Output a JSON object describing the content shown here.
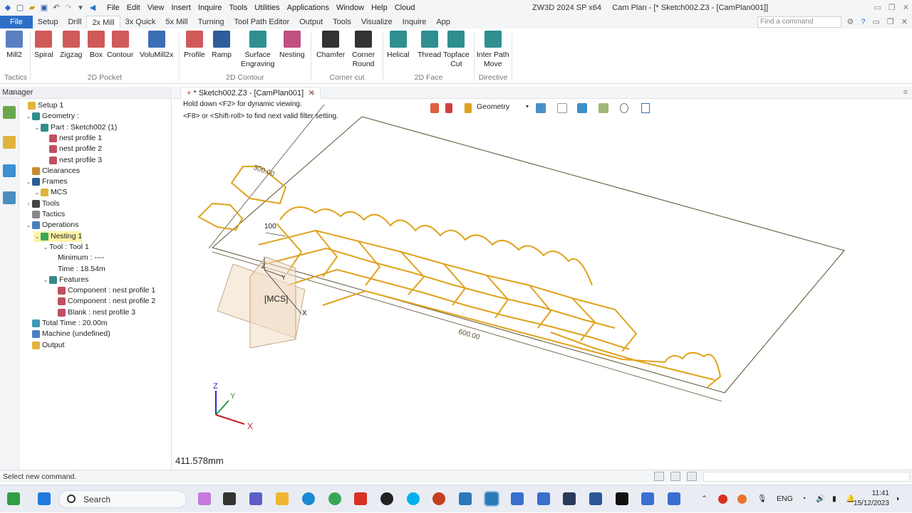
{
  "title_bar": {
    "menu": [
      "File",
      "Edit",
      "View",
      "Insert",
      "Inquire",
      "Tools",
      "Utilities",
      "Applications",
      "Window",
      "Help",
      "Cloud"
    ],
    "app_title": "ZW3D 2024 SP x64     Cam Plan - [* Sketch002.Z3 - [CamPlan001]]"
  },
  "ribbon_tabs": [
    "File",
    "Setup",
    "Drill",
    "2x Mill",
    "3x Quick",
    "5x Mill",
    "Turning",
    "Tool Path Editor",
    "Output",
    "Tools",
    "Visualize",
    "Inquire",
    "App"
  ],
  "active_tab": "2x Mill",
  "command_search": {
    "placeholder": "Find a command"
  },
  "ribbon": {
    "buttons": [
      {
        "label": "Mill2",
        "icon": "mill2-icon",
        "color": "#5a7fc0"
      },
      {
        "label": "Spiral",
        "icon": "spiral-icon",
        "color": "#d05a5a"
      },
      {
        "label": "Zigzag",
        "icon": "zigzag-icon",
        "color": "#d05a5a"
      },
      {
        "label": "Box",
        "icon": "box-icon",
        "color": "#d05a5a"
      },
      {
        "label": "Contour",
        "icon": "contour-icon",
        "color": "#d05a5a"
      },
      {
        "label": "VoluMill2x",
        "icon": "volumill-icon",
        "color": "#3b6fb5"
      },
      {
        "label": "Profile",
        "icon": "profile-icon",
        "color": "#d05a5a"
      },
      {
        "label": "Ramp",
        "icon": "ramp-icon",
        "color": "#2f5d9a"
      },
      {
        "label": "Surface\nEngraving",
        "icon": "engraving-icon",
        "color": "#2f8f8f"
      },
      {
        "label": "Nesting",
        "icon": "nesting-icon",
        "color": "#c05080"
      },
      {
        "label": "Chamfer",
        "icon": "chamfer-icon",
        "color": "#333333"
      },
      {
        "label": "Corner\nRound",
        "icon": "corner-round-icon",
        "color": "#333333"
      },
      {
        "label": "Helical",
        "icon": "helical-icon",
        "color": "#2f8f8f"
      },
      {
        "label": "Thread",
        "icon": "thread-icon",
        "color": "#2f8f8f"
      },
      {
        "label": "Topface\nCut",
        "icon": "topface-icon",
        "color": "#2f8f8f"
      },
      {
        "label": "Inter Path\nMove",
        "icon": "inter-path-icon",
        "color": "#2f8f8f"
      }
    ],
    "groups": [
      "Tactics",
      "2D Pocket",
      "2D Contour",
      "Corner cut",
      "2D Face",
      "Directive"
    ]
  },
  "manager": {
    "title": "Manager",
    "tree": [
      {
        "label": "Setup 1",
        "icon": "setup-icon"
      },
      {
        "label": "Geometry :",
        "icon": "geometry-icon"
      },
      {
        "label": "Part : Sketch002 (1)",
        "icon": "part-icon"
      },
      {
        "label": "nest profile 1",
        "icon": "profile-icon"
      },
      {
        "label": "nest profile 2",
        "icon": "profile-icon"
      },
      {
        "label": "nest profile 3",
        "icon": "profile-icon"
      },
      {
        "label": "Clearances",
        "icon": "clearances-icon"
      },
      {
        "label": "Frames",
        "icon": "frames-icon"
      },
      {
        "label": "MCS",
        "icon": "mcs-icon"
      },
      {
        "label": "Tools",
        "icon": "tools-icon"
      },
      {
        "label": "Tactics",
        "icon": "tactics-icon"
      },
      {
        "label": "Operations",
        "icon": "operations-icon"
      },
      {
        "label": "Nesting 1",
        "icon": "check-icon"
      },
      {
        "label": "Tool : Tool 1",
        "icon": ""
      },
      {
        "label": "Minimum : ----",
        "icon": ""
      },
      {
        "label": "Time : 18.54m",
        "icon": ""
      },
      {
        "label": "Features",
        "icon": "features-icon"
      },
      {
        "label": "Component : nest profile 1",
        "icon": "profile-icon"
      },
      {
        "label": "Component : nest profile 2",
        "icon": "profile-icon"
      },
      {
        "label": "Blank : nest profile 3",
        "icon": "profile-icon"
      },
      {
        "label": "Total Time : 20.00m",
        "icon": "time-icon"
      },
      {
        "label": "Machine (undefined)",
        "icon": "machine-icon"
      },
      {
        "label": "Output",
        "icon": "output-icon"
      }
    ]
  },
  "doc_tab": {
    "label": "* Sketch002.Z3 - [CamPlan001]"
  },
  "viewport": {
    "hint_1": "Hold down <F2> for dynamic viewing.",
    "hint_2": "<F8> or <Shift-roll> to find next valid filter setting.",
    "filter": "Geometry",
    "dim_100": "100",
    "dim_300": "300.00",
    "dim_600": "600.00",
    "mcs_label": "[MCS]",
    "axis_x": "X",
    "axis_y": "Y",
    "axis_z": "Z",
    "measure": "411.578mm",
    "colors": {
      "profile": "#e0a21c",
      "sheet": "#5a5030",
      "axis_x": "#c0202a",
      "axis_y": "#2e9a3a",
      "axis_z": "#2a2acc"
    }
  },
  "status_bar": {
    "message": "Select new command."
  },
  "taskbar": {
    "search": "Search",
    "lang": "ENG",
    "time": "11:41",
    "date": "15/12/2023"
  }
}
